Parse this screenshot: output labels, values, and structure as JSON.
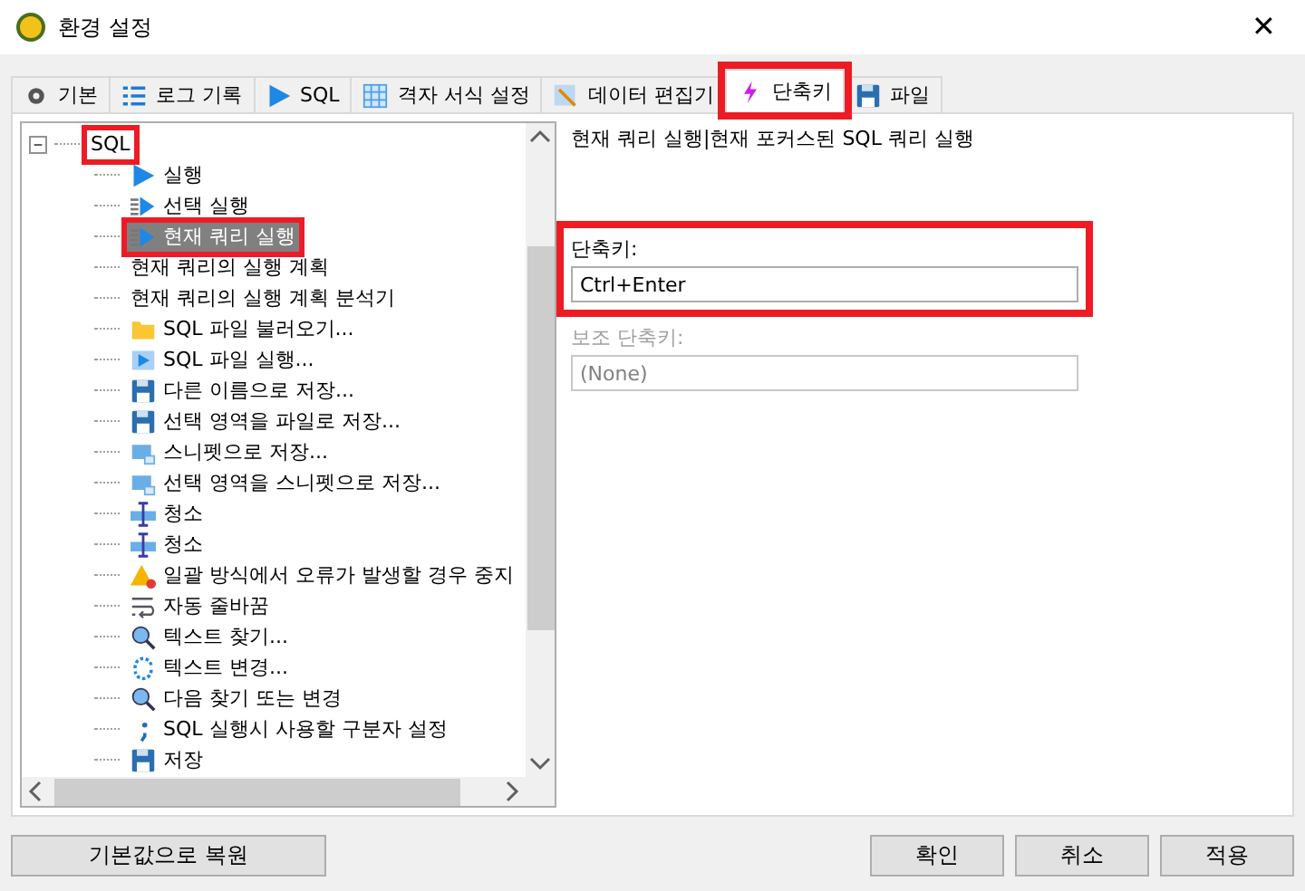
{
  "window": {
    "title": "환경 설정",
    "close": "✕"
  },
  "tabs": [
    {
      "label": "기본",
      "kind": "gear",
      "selected": false,
      "highlighted": false
    },
    {
      "label": "로그 기록",
      "kind": "list",
      "selected": false,
      "highlighted": false
    },
    {
      "label": "SQL",
      "kind": "play",
      "selected": false,
      "highlighted": false
    },
    {
      "label": "격자 서식 설정",
      "kind": "grid",
      "selected": false,
      "highlighted": false
    },
    {
      "label": "데이터 편집기",
      "kind": "edit",
      "selected": false,
      "highlighted": false
    },
    {
      "label": "단축키",
      "kind": "bolt",
      "selected": true,
      "highlighted": true
    },
    {
      "label": "파일",
      "kind": "disk",
      "selected": false,
      "highlighted": false
    }
  ],
  "tree": {
    "items": [
      {
        "label": "SQL",
        "expanded": true,
        "expander": "−",
        "highlighted": true,
        "selected": false,
        "children": [
          {
            "label": "실행",
            "kind": "play",
            "selected": false,
            "highlighted": false
          },
          {
            "label": "선택 실행",
            "kind": "listplay",
            "selected": false,
            "highlighted": false
          },
          {
            "label": "현재 쿼리 실행",
            "kind": "listplay",
            "selected": true,
            "highlighted": true
          },
          {
            "label": "현재 쿼리의 실행 계획",
            "kind": "none",
            "selected": false,
            "highlighted": false
          },
          {
            "label": "현재 쿼리의 실행 계획 분석기",
            "kind": "none",
            "selected": false,
            "highlighted": false
          },
          {
            "label": "SQL 파일 불러오기...",
            "kind": "folder",
            "selected": false,
            "highlighted": false
          },
          {
            "label": "SQL 파일 실행...",
            "kind": "fileplay",
            "selected": false,
            "highlighted": false
          },
          {
            "label": "다른 이름으로 저장...",
            "kind": "disk",
            "selected": false,
            "highlighted": false
          },
          {
            "label": "선택 영역을 파일로 저장...",
            "kind": "disk",
            "selected": false,
            "highlighted": false
          },
          {
            "label": "스니펫으로 저장...",
            "kind": "snippet",
            "selected": false,
            "highlighted": false
          },
          {
            "label": "선택 영역을 스니펫으로 저장...",
            "kind": "snippet",
            "selected": false,
            "highlighted": false
          },
          {
            "label": "청소",
            "kind": "cursor",
            "selected": false,
            "highlighted": false
          },
          {
            "label": "청소",
            "kind": "cursor",
            "selected": false,
            "highlighted": false
          },
          {
            "label": "일괄 방식에서 오류가 발생할 경우 중지",
            "kind": "warning",
            "selected": false,
            "highlighted": false
          },
          {
            "label": "자동 줄바꿈",
            "kind": "wrap",
            "selected": false,
            "highlighted": false
          },
          {
            "label": "텍스트 찾기...",
            "kind": "search",
            "selected": false,
            "highlighted": false
          },
          {
            "label": "텍스트 변경...",
            "kind": "replace",
            "selected": false,
            "highlighted": false
          },
          {
            "label": "다음 찾기 또는 변경",
            "kind": "search",
            "selected": false,
            "highlighted": false
          },
          {
            "label": "SQL 실행시 사용할 구분자 설정",
            "kind": "semicolon",
            "selected": false,
            "highlighted": false
          },
          {
            "label": "저장",
            "kind": "disk",
            "selected": false,
            "highlighted": false
          }
        ]
      }
    ]
  },
  "detail": {
    "description": "현재 쿼리 실행|현재 포커스된 SQL 쿼리 실행",
    "shortcut": {
      "label": "단축키:",
      "value": "Ctrl+Enter",
      "disabled": false,
      "highlighted": true
    },
    "secondary": {
      "label": "보조 단축키:",
      "value": "(None)",
      "disabled": true
    }
  },
  "buttons": {
    "restore": "기본값으로 복원",
    "ok": "확인",
    "cancel": "취소",
    "apply": "적용"
  }
}
